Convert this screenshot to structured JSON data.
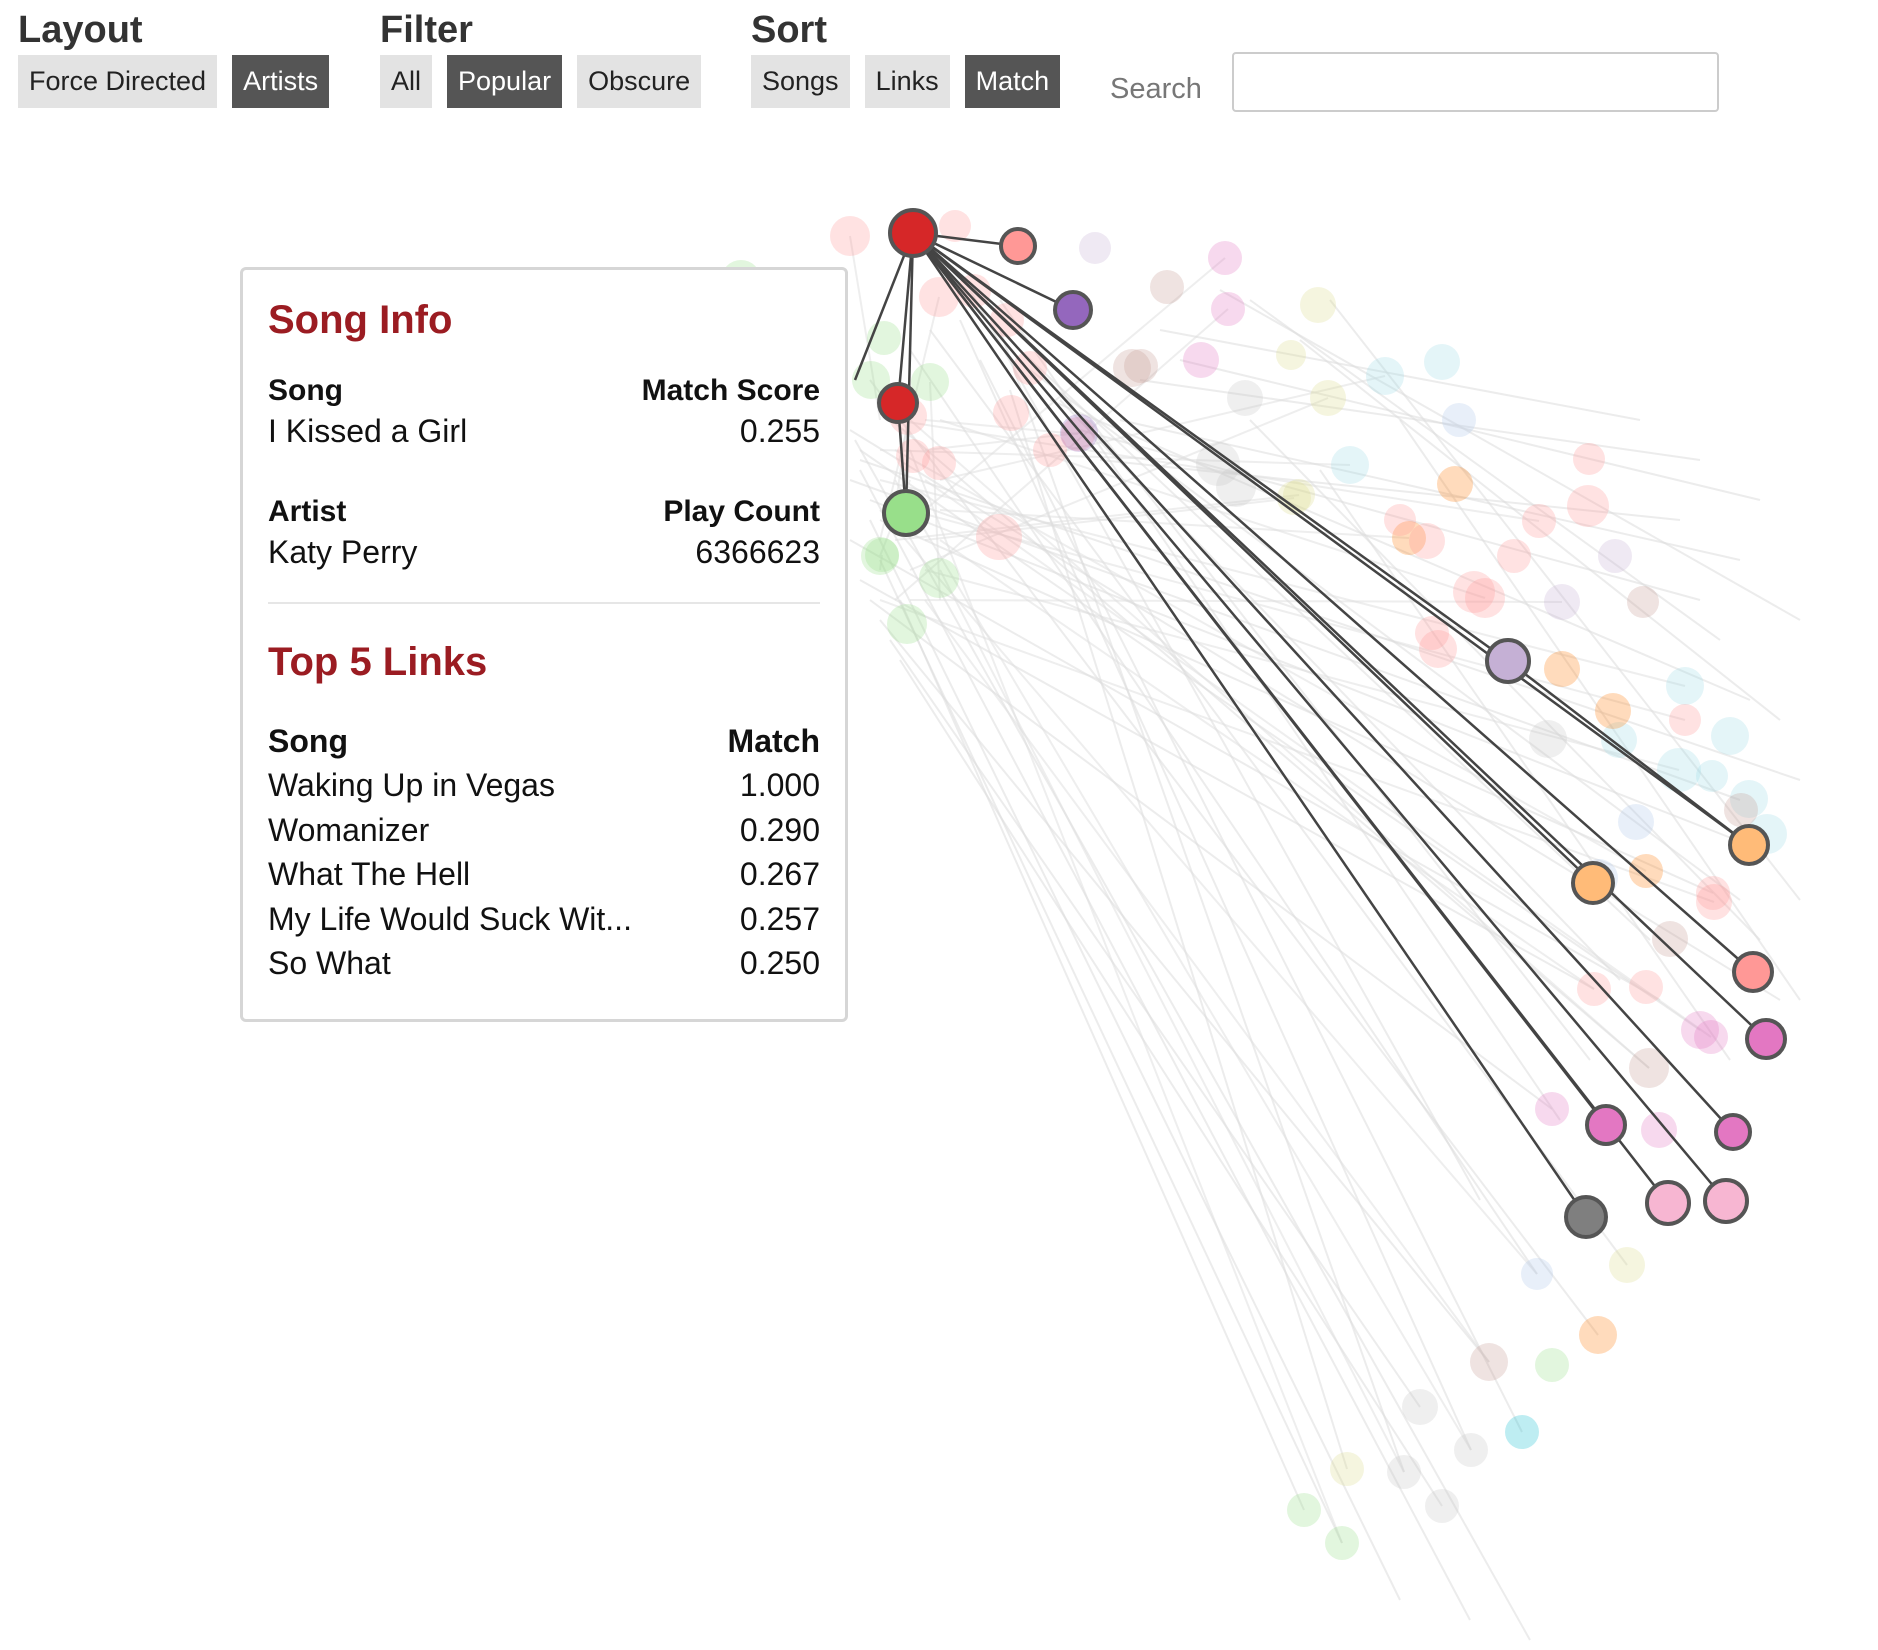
{
  "controls": {
    "layout": {
      "title": "Layout",
      "buttons": [
        {
          "label": "Force Directed",
          "active": false
        },
        {
          "label": "Artists",
          "active": true
        }
      ]
    },
    "filter": {
      "title": "Filter",
      "buttons": [
        {
          "label": "All",
          "active": false
        },
        {
          "label": "Popular",
          "active": true
        },
        {
          "label": "Obscure",
          "active": false
        }
      ]
    },
    "sort": {
      "title": "Sort",
      "buttons": [
        {
          "label": "Songs",
          "active": false
        },
        {
          "label": "Links",
          "active": false
        },
        {
          "label": "Match",
          "active": true
        }
      ]
    },
    "search": {
      "label": "Search",
      "value": "",
      "placeholder": ""
    }
  },
  "song_info": {
    "heading": "Song Info",
    "song_label": "Song",
    "song_value": "I Kissed a Girl",
    "match_score_label": "Match Score",
    "match_score_value": "0.255",
    "artist_label": "Artist",
    "artist_value": "Katy Perry",
    "play_count_label": "Play Count",
    "play_count_value": "6366623"
  },
  "top_links": {
    "heading": "Top 5 Links",
    "song_header": "Song",
    "match_header": "Match",
    "rows": [
      {
        "song": "Waking Up in Vegas",
        "match": "1.000"
      },
      {
        "song": "Womanizer",
        "match": "0.290"
      },
      {
        "song": "What The Hell",
        "match": "0.267"
      },
      {
        "song": "My Life Would Suck Wit...",
        "match": "0.257"
      },
      {
        "song": "So What",
        "match": "0.250"
      }
    ]
  },
  "graph": {
    "colors": {
      "selected": "#d62728",
      "link_highlight": "#444444",
      "link_faded": "#dddddd",
      "node_stroke": "#555555"
    },
    "palette": [
      "#d62728",
      "#ff9896",
      "#9467bd",
      "#c5b0d5",
      "#ffbb78",
      "#ff7f0e",
      "#e377c2",
      "#f7b6d2",
      "#7f7f7f",
      "#c7c7c7",
      "#98df8a",
      "#2ca02c",
      "#17becf",
      "#9edae5",
      "#bcbd22",
      "#dbdb8d",
      "#1f77b4",
      "#aec7e8",
      "#8c564b",
      "#c49c94"
    ]
  }
}
